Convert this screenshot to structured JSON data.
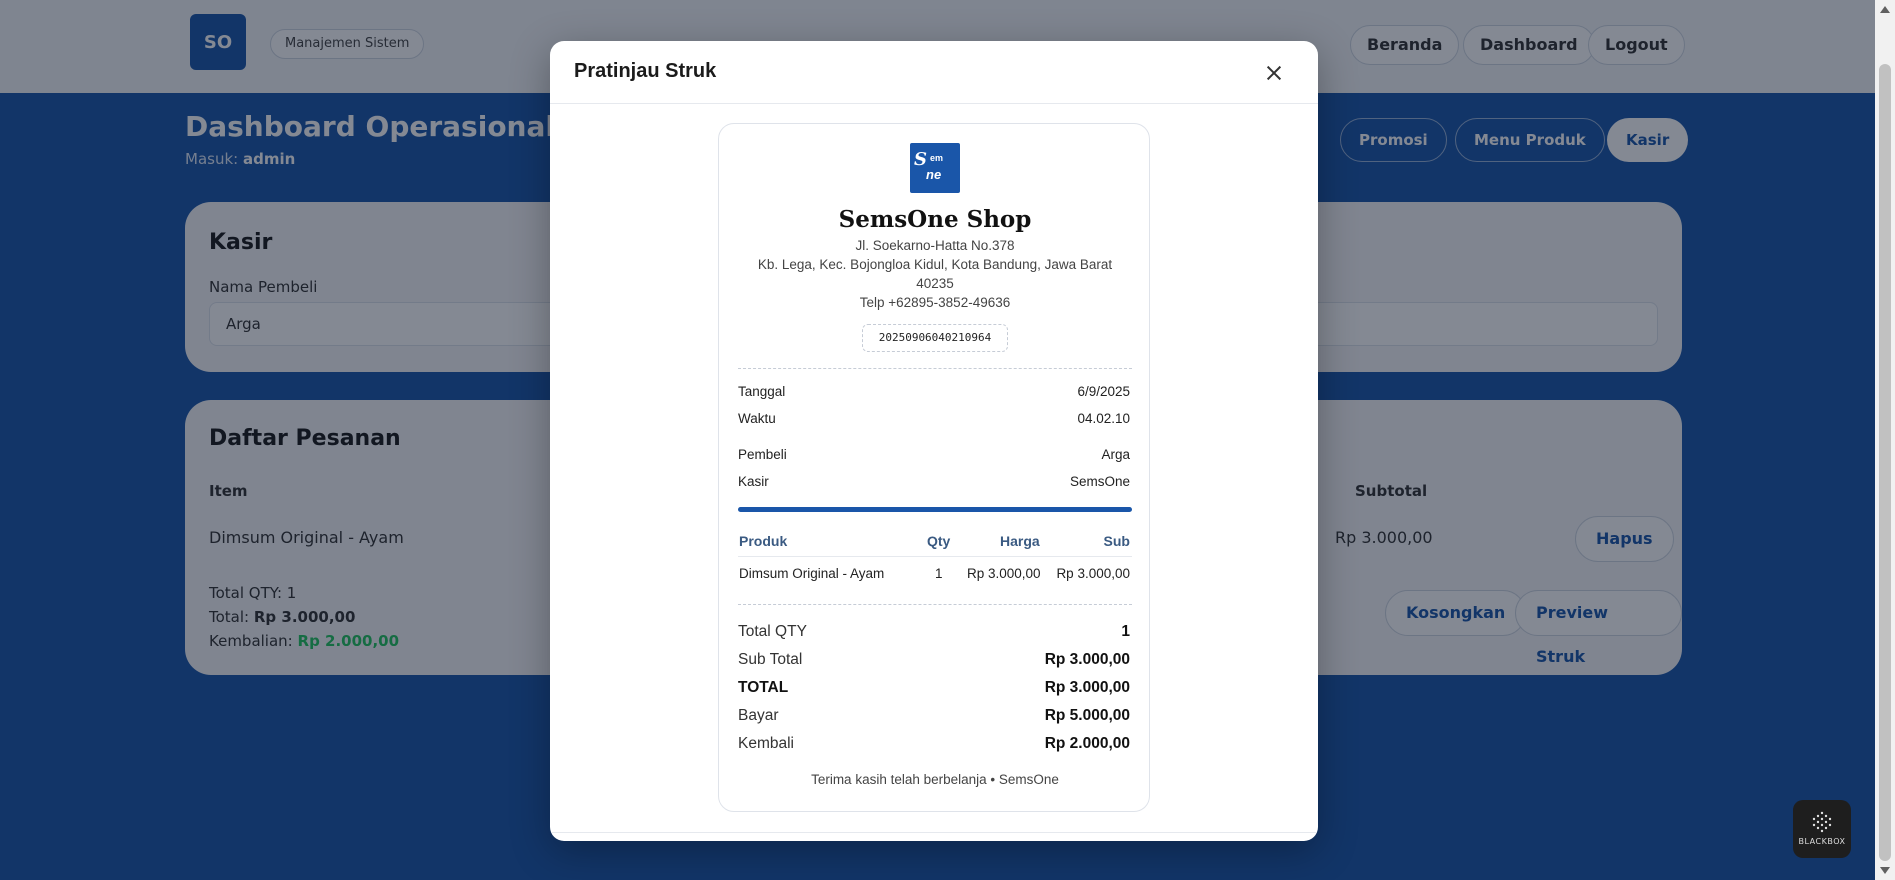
{
  "background": {
    "brand_initials": "SO",
    "role_label": "Manajemen Sistem",
    "nav": [
      "Beranda",
      "Dashboard",
      "Logout"
    ],
    "dashboard_title": "Dashboard Operasional",
    "login_prefix": "Masuk:",
    "login_user": "admin",
    "tabs": [
      "Promosi",
      "Menu Produk",
      "Kasir"
    ],
    "kasir_card": {
      "title": "Kasir",
      "buyer_label": "Nama Pembeli",
      "buyer_value": "Arga"
    },
    "orders_card": {
      "title": "Daftar Pesanan",
      "col_item": "Item",
      "col_subtotal": "Subtotal",
      "row_item": "Dimsum Original - Ayam",
      "row_subtotal": "Rp 3.000,00",
      "row_action": "Hapus",
      "total_qty": "Total QTY: 1",
      "total_prefix": "Total:",
      "total_value": "Rp 3.000,00",
      "change_prefix": "Kembalian:",
      "change_value": "Rp 2.000,00",
      "btn_clear": "Kosongkan",
      "btn_preview": "Preview Struk"
    }
  },
  "modal": {
    "title": "Pratinjau Struk",
    "receipt": {
      "logo_text": "SemsOne",
      "shop_name": "SemsOne Shop",
      "address_line1": "Jl. Soekarno-Hatta No.378",
      "address_line2": "Kb. Lega, Kec. Bojongloa Kidul, Kota Bandung, Jawa Barat",
      "address_line3": "40235",
      "phone": "Telp +62895-3852-49636",
      "transaction_id": "20250906040210964",
      "date_label": "Tanggal",
      "date_value": "6/9/2025",
      "time_label": "Waktu",
      "time_value": "04.02.10",
      "buyer_label": "Pembeli",
      "buyer_value": "Arga",
      "cashier_label": "Kasir",
      "cashier_value": "SemsOne",
      "table": {
        "headers": [
          "Produk",
          "Qty",
          "Harga",
          "Sub"
        ],
        "rows": [
          [
            "Dimsum Original - Ayam",
            "1",
            "Rp 3.000,00",
            "Rp 3.000,00"
          ]
        ]
      },
      "summary": {
        "total_qty_label": "Total QTY",
        "total_qty_value": "1",
        "subtotal_label": "Sub Total",
        "subtotal_value": "Rp 3.000,00",
        "total_label": "TOTAL",
        "total_value": "Rp 3.000,00",
        "pay_label": "Bayar",
        "pay_value": "Rp 5.000,00",
        "change_label": "Kembali",
        "change_value": "Rp 2.000,00"
      },
      "thanks": "Terima kasih telah berbelanja • SemsOne"
    }
  },
  "widget": {
    "label": "BLACKBOX"
  },
  "colors": {
    "brand_blue": "#1a56a9",
    "table_header": "#3a5a82",
    "success_green": "#22c55e"
  }
}
